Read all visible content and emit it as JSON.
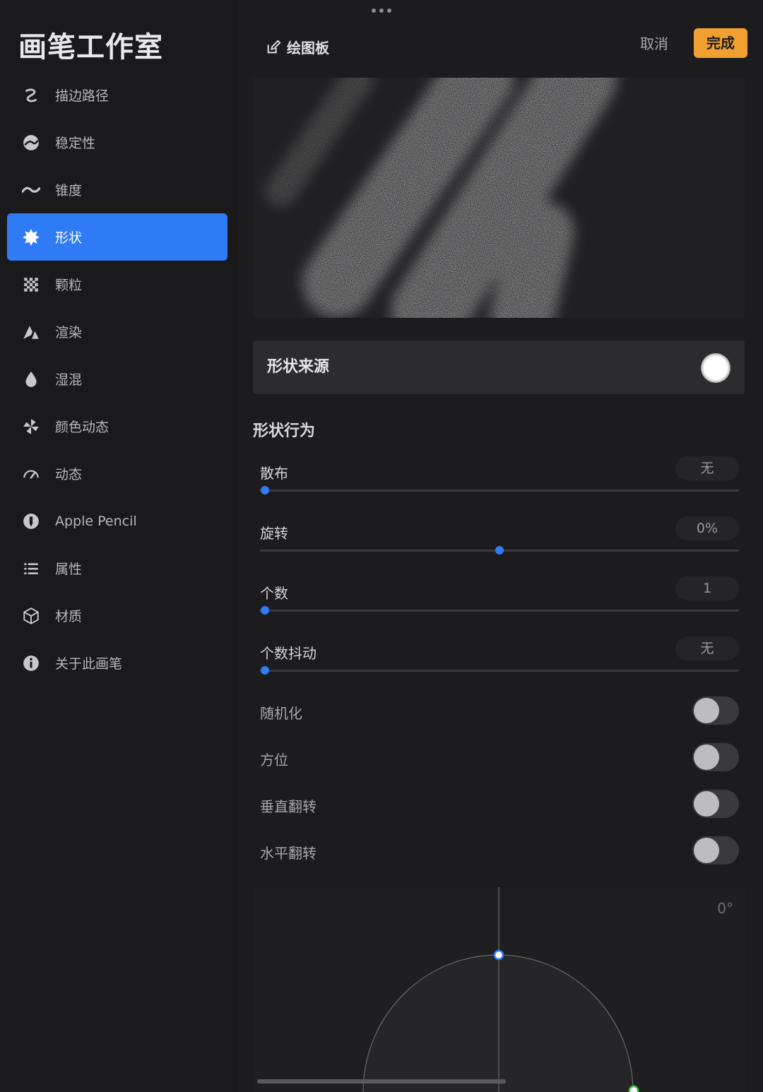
{
  "sidebar": {
    "title": "画笔工作室",
    "items": [
      {
        "label": "描边路径",
        "icon": "stroke-path-icon",
        "active": false
      },
      {
        "label": "稳定性",
        "icon": "stabilization-icon",
        "active": false
      },
      {
        "label": "锥度",
        "icon": "taper-icon",
        "active": false
      },
      {
        "label": "形状",
        "icon": "shape-icon",
        "active": true
      },
      {
        "label": "颗粒",
        "icon": "grain-icon",
        "active": false
      },
      {
        "label": "渲染",
        "icon": "rendering-icon",
        "active": false
      },
      {
        "label": "湿混",
        "icon": "wet-mix-icon",
        "active": false
      },
      {
        "label": "颜色动态",
        "icon": "color-dynamics-icon",
        "active": false
      },
      {
        "label": "动态",
        "icon": "dynamics-icon",
        "active": false
      },
      {
        "label": "Apple Pencil",
        "icon": "apple-pencil-icon",
        "active": false
      },
      {
        "label": "属性",
        "icon": "properties-icon",
        "active": false
      },
      {
        "label": "材质",
        "icon": "materials-icon",
        "active": false
      },
      {
        "label": "关于此画笔",
        "icon": "info-icon",
        "active": false
      }
    ]
  },
  "header": {
    "drawing_pad_label": "绘图板",
    "cancel_label": "取消",
    "done_label": "完成"
  },
  "shape_source": {
    "label": "形状来源"
  },
  "shape_behavior": {
    "title": "形状行为",
    "sliders": [
      {
        "label": "散布",
        "value": "无",
        "position": 0.01
      },
      {
        "label": "旋转",
        "value": "0%",
        "position": 0.5
      },
      {
        "label": "个数",
        "value": "1",
        "position": 0.01
      },
      {
        "label": "个数抖动",
        "value": "无",
        "position": 0.01
      }
    ],
    "toggles": [
      {
        "label": "随机化",
        "on": false
      },
      {
        "label": "方位",
        "on": false
      },
      {
        "label": "垂直翻转",
        "on": false
      },
      {
        "label": "水平翻转",
        "on": false
      }
    ]
  },
  "angle_editor": {
    "value": "0°"
  },
  "colors": {
    "accent": "#2f7bf5",
    "done_button": "#f0a030",
    "background": "#1c1c1e"
  }
}
